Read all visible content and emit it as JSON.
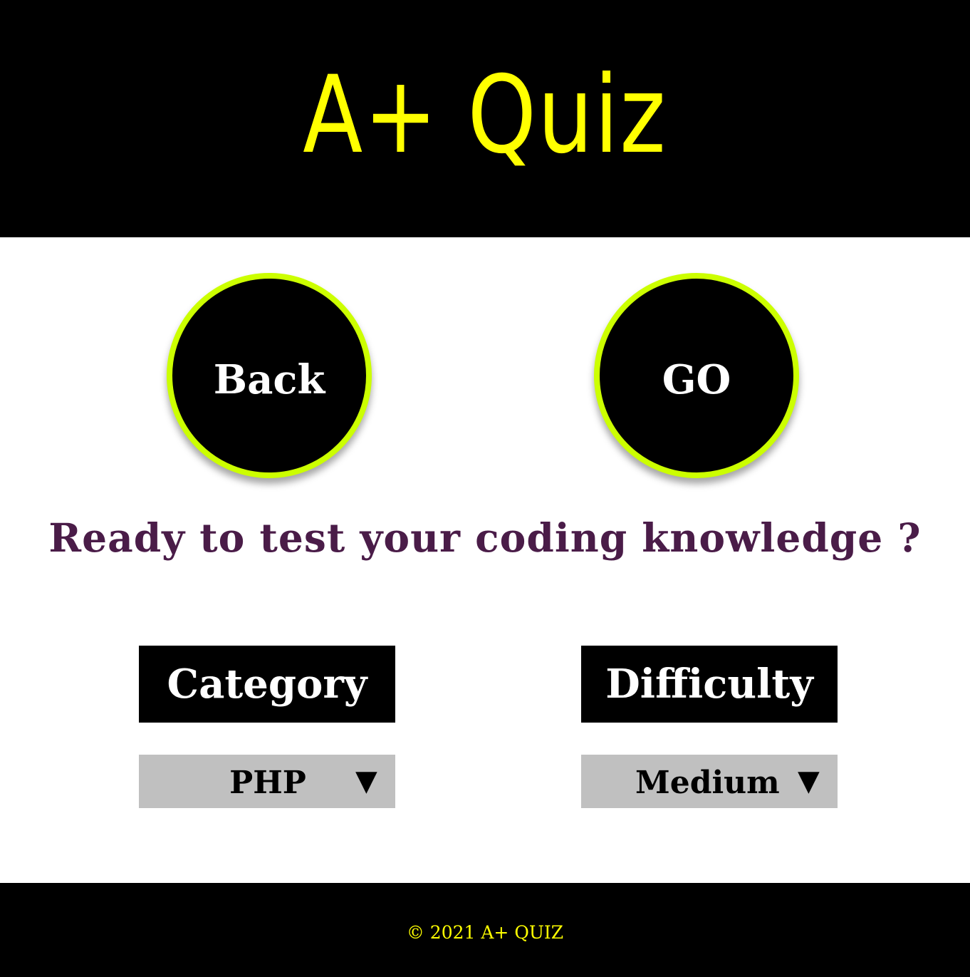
{
  "colors": {
    "accent": "#ffff00",
    "ring": "#ccff00",
    "headline": "#4a1c48",
    "dark": "#000000",
    "select_bg": "#c0c0c0"
  },
  "header": {
    "logo": "A+ Quiz"
  },
  "buttons": {
    "back_label": "Back",
    "go_label": "GO"
  },
  "headline": "Ready to test your coding knowledge ?",
  "category": {
    "label": "Category",
    "selected": "PHP",
    "arrow_icon": "triangle-down"
  },
  "difficulty": {
    "label": "Difficulty",
    "selected": "Medium",
    "arrow_icon": "triangle-down"
  },
  "footer": {
    "text": "© 2021 A+ QUIZ"
  }
}
